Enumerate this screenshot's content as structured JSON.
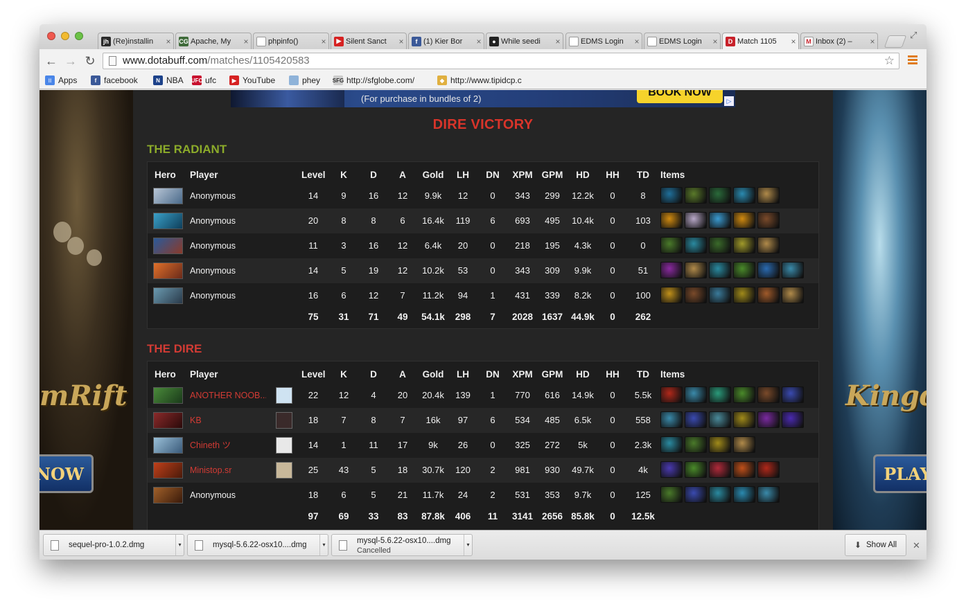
{
  "browser": {
    "tabs": [
      {
        "title": "(Re)installin",
        "fav": "jh",
        "favbg": "#2a2a2a",
        "icon": "jh-favicon-icon"
      },
      {
        "title": "Apache, My",
        "fav": "CG",
        "favbg": "#3f6b3a",
        "icon": "cg-favicon-icon"
      },
      {
        "title": "phpinfo()",
        "fav": "",
        "favbg": "#ffffff",
        "icon": "page-icon"
      },
      {
        "title": "Silent Sanct",
        "fav": "▶",
        "favbg": "#d62222",
        "icon": "youtube-icon"
      },
      {
        "title": "(1) Kier Bor",
        "fav": "f",
        "favbg": "#3b5998",
        "icon": "facebook-icon"
      },
      {
        "title": "While seedi",
        "fav": "●",
        "favbg": "#222222",
        "icon": "github-icon"
      },
      {
        "title": "EDMS Login",
        "fav": "",
        "favbg": "#ffffff",
        "icon": "page-icon"
      },
      {
        "title": "EDMS Login",
        "fav": "",
        "favbg": "#ffffff",
        "icon": "page-icon"
      },
      {
        "title": "Match 1105",
        "fav": "D",
        "favbg": "#c8222b",
        "icon": "dotabuff-icon"
      },
      {
        "title": "Inbox (2) –",
        "fav": "M",
        "favbg": "#ffffff",
        "icon": "gmail-icon"
      }
    ],
    "url_domain": "www.dotabuff.com",
    "url_path": "/matches/1105420583",
    "bookmarks": [
      {
        "label": "Apps",
        "fav": "⁝⁝",
        "favbg": "#4a86e8"
      },
      {
        "label": "facebook",
        "fav": "f",
        "favbg": "#3b5998"
      },
      {
        "label": "NBA",
        "fav": "N",
        "favbg": "#1d428a"
      },
      {
        "label": "ufc",
        "fav": "UFC",
        "favbg": "#c8102e"
      },
      {
        "label": "YouTube",
        "fav": "▶",
        "favbg": "#d62222"
      },
      {
        "label": "phey",
        "fav": "",
        "favbg": "#8fb3d9"
      },
      {
        "label": "http://sfglobe.com/",
        "fav": "SFG",
        "favbg": "#cccccc"
      },
      {
        "label": "http://www.tipidcp.c",
        "fav": "◆",
        "favbg": "#e0b040"
      }
    ]
  },
  "ad": {
    "text": "(For purchase in bundles of 2)",
    "button": "BOOK NOW",
    "left_logo": "mRift",
    "left_button": "NOW",
    "right_logo": "Kingd",
    "right_button": "PLAY"
  },
  "match": {
    "result": "DIRE VICTORY",
    "result_color": "#d8342a",
    "columns": [
      "Hero",
      "Player",
      "Level",
      "K",
      "D",
      "A",
      "Gold",
      "LH",
      "DN",
      "XPM",
      "GPM",
      "HD",
      "HH",
      "TD",
      "Items"
    ],
    "radiant": {
      "name": "THE RADIANT",
      "color": "#8cab2a",
      "players": [
        {
          "player": "Anonymous",
          "linked": false,
          "level": "14",
          "k": "9",
          "d": "16",
          "a": "12",
          "gold": "9.9k",
          "lh": "12",
          "dn": "0",
          "xpm": "343",
          "gpm": "299",
          "hd": "12.2k",
          "hh": "0",
          "td": "8",
          "hero_color": [
            "#b9c6d6",
            "#4a6a8a"
          ],
          "items": [
            "#1f6f9a",
            "#5a7a2a",
            "#2a6a3a",
            "#2a8ab0",
            "#b08a4a"
          ]
        },
        {
          "player": "Anonymous",
          "linked": false,
          "level": "20",
          "k": "8",
          "d": "8",
          "a": "6",
          "gold": "16.4k",
          "lh": "119",
          "dn": "6",
          "xpm": "693",
          "gpm": "495",
          "hd": "10.4k",
          "hh": "0",
          "td": "103",
          "hero_color": [
            "#3aa0c8",
            "#0e3e5a"
          ],
          "items": [
            "#d08a10",
            "#b8a8c8",
            "#3a9ad0",
            "#d08a10",
            "#7a4a2a"
          ]
        },
        {
          "player": "Anonymous",
          "linked": false,
          "level": "11",
          "k": "3",
          "d": "16",
          "a": "12",
          "gold": "6.4k",
          "lh": "20",
          "dn": "0",
          "xpm": "218",
          "gpm": "195",
          "hd": "4.3k",
          "hh": "0",
          "td": "0",
          "hero_color": [
            "#2a5a9a",
            "#8a3a2a"
          ],
          "items": [
            "#4a7a2a",
            "#2a8aa0",
            "#3a6a2a",
            "#a09a2a",
            "#b08a4a"
          ]
        },
        {
          "player": "Anonymous",
          "linked": false,
          "level": "14",
          "k": "5",
          "d": "19",
          "a": "12",
          "gold": "10.2k",
          "lh": "53",
          "dn": "0",
          "xpm": "343",
          "gpm": "309",
          "hd": "9.9k",
          "hh": "0",
          "td": "51",
          "hero_color": [
            "#e0702a",
            "#6a2a1a"
          ],
          "items": [
            "#8a2aa0",
            "#b08a4a",
            "#2a8aa0",
            "#4a8a2a",
            "#2a6ab0",
            "#3a8aaa"
          ]
        },
        {
          "player": "Anonymous",
          "linked": false,
          "level": "16",
          "k": "6",
          "d": "12",
          "a": "7",
          "gold": "11.2k",
          "lh": "94",
          "dn": "1",
          "xpm": "431",
          "gpm": "339",
          "hd": "8.2k",
          "hh": "0",
          "td": "100",
          "hero_color": [
            "#6a9ab0",
            "#2a3a4a"
          ],
          "items": [
            "#c0901a",
            "#7a4a2a",
            "#3a7a9a",
            "#a08a1a",
            "#a05a2a",
            "#b08a4a"
          ]
        }
      ],
      "totals": {
        "level": "75",
        "k": "31",
        "d": "71",
        "a": "49",
        "gold": "54.1k",
        "lh": "298",
        "dn": "7",
        "xpm": "2028",
        "gpm": "1637",
        "hd": "44.9k",
        "hh": "0",
        "td": "262"
      }
    },
    "dire": {
      "name": "THE DIRE",
      "color": "#d23b34",
      "players": [
        {
          "player": "ANOTHER NOOB...",
          "linked": true,
          "level": "22",
          "k": "12",
          "d": "4",
          "a": "20",
          "gold": "20.4k",
          "lh": "139",
          "dn": "1",
          "xpm": "770",
          "gpm": "616",
          "hd": "14.9k",
          "hh": "0",
          "td": "5.5k",
          "hero_color": [
            "#4a8a3a",
            "#1a3a1a"
          ],
          "avatar_color": "#cfe3f2",
          "items": [
            "#b0281a",
            "#3a8aaa",
            "#2a9a7a",
            "#4a8a2a",
            "#7a4a2a",
            "#3a4ab0"
          ]
        },
        {
          "player": "KB",
          "linked": true,
          "level": "18",
          "k": "7",
          "d": "8",
          "a": "7",
          "gold": "16k",
          "lh": "97",
          "dn": "6",
          "xpm": "534",
          "gpm": "485",
          "hd": "6.5k",
          "hh": "0",
          "td": "558",
          "hero_color": [
            "#8a2a2a",
            "#2a0a0a"
          ],
          "avatar_color": "#3a2a2a",
          "items": [
            "#3a8aaa",
            "#3a4ab0",
            "#4a8a9a",
            "#a08a1a",
            "#7a2aa0",
            "#4a2ab0"
          ]
        },
        {
          "player": "Chineth ツ",
          "linked": true,
          "level": "14",
          "k": "1",
          "d": "11",
          "a": "17",
          "gold": "9k",
          "lh": "26",
          "dn": "0",
          "xpm": "325",
          "gpm": "272",
          "hd": "5k",
          "hh": "0",
          "td": "2.3k",
          "hero_color": [
            "#9ac0d8",
            "#3a5a7a"
          ],
          "avatar_color": "#e8e8e8",
          "items": [
            "#2a8aa0",
            "#4a7a2a",
            "#a08a1a",
            "#b08a4a"
          ]
        },
        {
          "player": "Ministop.sr",
          "linked": true,
          "level": "25",
          "k": "43",
          "d": "5",
          "a": "18",
          "gold": "30.7k",
          "lh": "120",
          "dn": "2",
          "xpm": "981",
          "gpm": "930",
          "hd": "49.7k",
          "hh": "0",
          "td": "4k",
          "hero_color": [
            "#c0401a",
            "#4a1a0a"
          ],
          "avatar_color": "#c8b89a",
          "items": [
            "#4a3ab0",
            "#4a8a2a",
            "#b02a3a",
            "#c0501a",
            "#b0281a"
          ]
        },
        {
          "player": "Anonymous",
          "linked": false,
          "level": "18",
          "k": "6",
          "d": "5",
          "a": "21",
          "gold": "11.7k",
          "lh": "24",
          "dn": "2",
          "xpm": "531",
          "gpm": "353",
          "hd": "9.7k",
          "hh": "0",
          "td": "125",
          "hero_color": [
            "#a0602a",
            "#3a1a0a"
          ],
          "avatar_color": "",
          "items": [
            "#4a7a2a",
            "#3a4ab0",
            "#2a8aa0",
            "#2a8ab0",
            "#3a8aaa"
          ]
        }
      ],
      "totals": {
        "level": "97",
        "k": "69",
        "d": "33",
        "a": "83",
        "gold": "87.8k",
        "lh": "406",
        "dn": "11",
        "xpm": "3141",
        "gpm": "2656",
        "hd": "85.8k",
        "hh": "0",
        "td": "12.5k"
      }
    }
  },
  "downloads": {
    "items": [
      {
        "name": "sequel-pro-1.0.2.dmg",
        "status": ""
      },
      {
        "name": "mysql-5.6.22-osx10....dmg",
        "status": ""
      },
      {
        "name": "mysql-5.6.22-osx10....dmg",
        "status": "Cancelled"
      }
    ],
    "show_all": "Show All"
  }
}
